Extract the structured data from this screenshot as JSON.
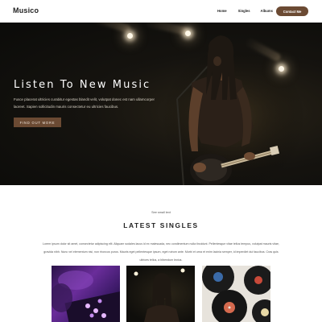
{
  "header": {
    "logo": "Musico",
    "nav": [
      "Home",
      "Singles",
      "Albums"
    ],
    "contact_label": "Contact Me"
  },
  "hero": {
    "title": "Listen To New Music",
    "text": "Fusce placerat ultricies curabitur egestas blandit velit, volutpat donec est nam ullamcorper laoreet. Sapien sollicitudin mauris consectetur eu ultricies faucibus.",
    "button_label": "FIND OUT MORE"
  },
  "singles": {
    "see_label": "See small text",
    "title": "LATEST SINGLES",
    "text": "Lorem ipsum dolor sit amet, consectetur adipiscing elit. Aliquam sodales lacus id ex malesuada, nec condimentum nulla tincidunt. Pellentesque vitae tellus tempus, volutpat mauris vitae, gravida nibh. Nunc vel elementum nisi, non rhoncus purus. Mauris eget pellentesque ipsum, eget rutrum ante. Morbi et urna et enim lacinia semper, id imperdiet dui faucibus. Cras quis ultrices tellus, a bibendum lectus."
  },
  "colors": {
    "accent": "#6b4a33",
    "hero_bg": "#0f0e0b",
    "text": "#222222"
  },
  "thumbnails": [
    "dj-mixer-image",
    "guitarist-image",
    "vinyl-records-image"
  ]
}
